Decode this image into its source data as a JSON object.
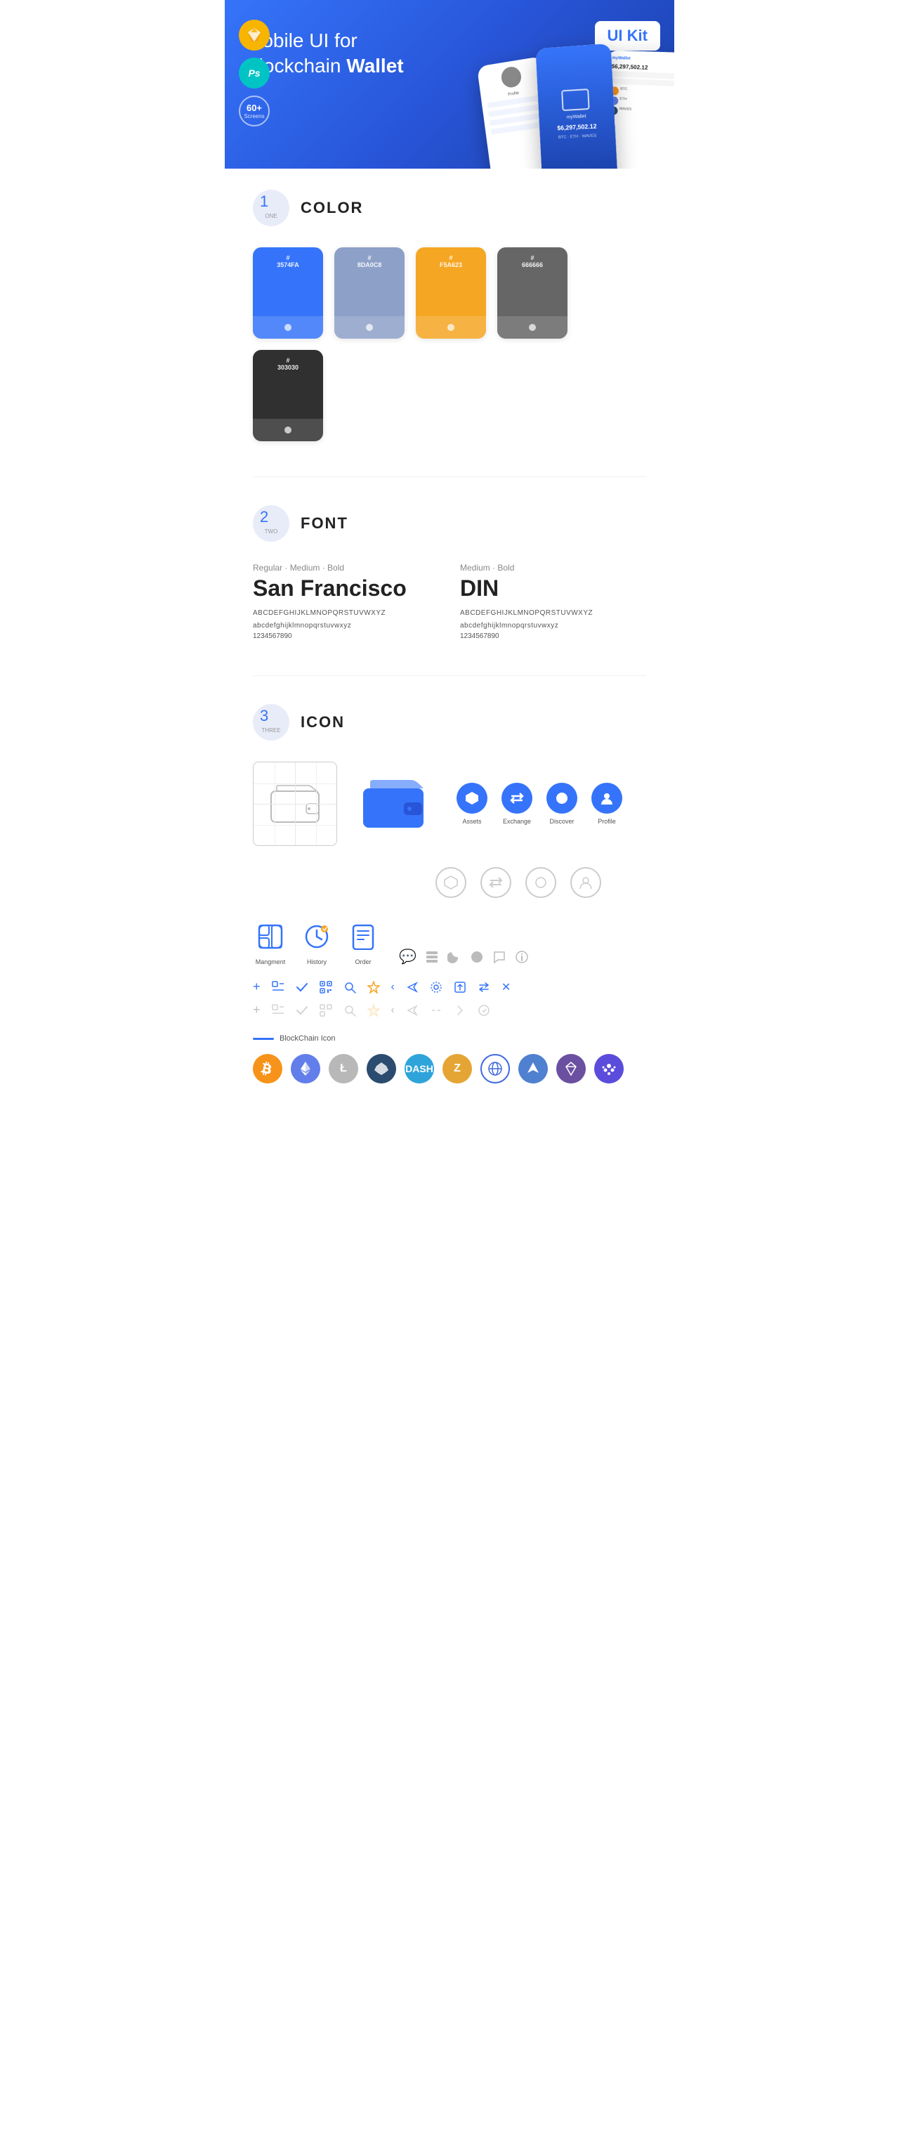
{
  "hero": {
    "title_normal": "Mobile UI for Blockchain ",
    "title_bold": "Wallet",
    "badge": "UI Kit",
    "badges": [
      {
        "label": "Sk",
        "type": "sketch"
      },
      {
        "label": "Ps",
        "type": "ps"
      },
      {
        "label": "60+",
        "sub": "Screens",
        "type": "screens"
      }
    ]
  },
  "sections": {
    "color": {
      "number": "1",
      "word": "ONE",
      "title": "COLOR",
      "swatches": [
        {
          "hex": "#3574FA",
          "label": "#\n3574FA"
        },
        {
          "hex": "#8DA0C8",
          "label": "#\n8DA0C8"
        },
        {
          "hex": "#F5A623",
          "label": "#\nF5A623"
        },
        {
          "hex": "#666666",
          "label": "#\n666666"
        },
        {
          "hex": "#303030",
          "label": "#\n303030"
        }
      ]
    },
    "font": {
      "number": "2",
      "word": "TWO",
      "title": "FONT",
      "fonts": [
        {
          "styles": "Regular · Medium · Bold",
          "name": "San Francisco",
          "uppercase": "ABCDEFGHIJKLMNOPQRSTUVWXYZ",
          "lowercase": "abcdefghijklmnopqrstuvwxyz",
          "numbers": "1234567890"
        },
        {
          "styles": "Medium · Bold",
          "name": "DIN",
          "uppercase": "ABCDEFGHIJKLMNOPQRSTUVWXYZ",
          "lowercase": "abcdefghijklmnopqrstuvwxyz",
          "numbers": "1234567890"
        }
      ]
    },
    "icon": {
      "number": "3",
      "word": "THREE",
      "title": "ICON",
      "nav_icons": [
        {
          "label": "Assets",
          "symbol": "◆"
        },
        {
          "label": "Exchange",
          "symbol": "⇄"
        },
        {
          "label": "Discover",
          "symbol": "●"
        },
        {
          "label": "Profile",
          "symbol": "👤"
        }
      ],
      "app_icons": [
        {
          "label": "Mangment",
          "symbol": "▤"
        },
        {
          "label": "History",
          "symbol": "🕐"
        },
        {
          "label": "Order",
          "symbol": "📋"
        }
      ],
      "small_icons_row1": [
        "+",
        "▣",
        "✓",
        "▦",
        "🔍",
        "☆",
        "‹",
        "‹",
        "⚙",
        "⬛",
        "⬜",
        "✕"
      ],
      "blockchain_label": "BlockChain Icon",
      "crypto_icons": [
        {
          "symbol": "₿",
          "color": "#F7931A",
          "label": "BTC"
        },
        {
          "symbol": "Ξ",
          "color": "#627EEA",
          "label": "ETH"
        },
        {
          "symbol": "Ł",
          "color": "#B8B8B8",
          "label": "LTC"
        },
        {
          "symbol": "◆",
          "color": "#2B4B6F",
          "label": ""
        },
        {
          "symbol": "Đ",
          "color": "#2FA4DA",
          "label": "DASH"
        },
        {
          "symbol": "Z",
          "color": "#E5A535",
          "label": "ZEC"
        },
        {
          "symbol": "◈",
          "color": "#4169E1",
          "label": ""
        },
        {
          "symbol": "▲",
          "color": "#5080D0",
          "label": "ARK"
        },
        {
          "symbol": "◇",
          "color": "#6B4FA0",
          "label": ""
        },
        {
          "symbol": "∞",
          "color": "#5B4CDB",
          "label": ""
        }
      ]
    }
  }
}
